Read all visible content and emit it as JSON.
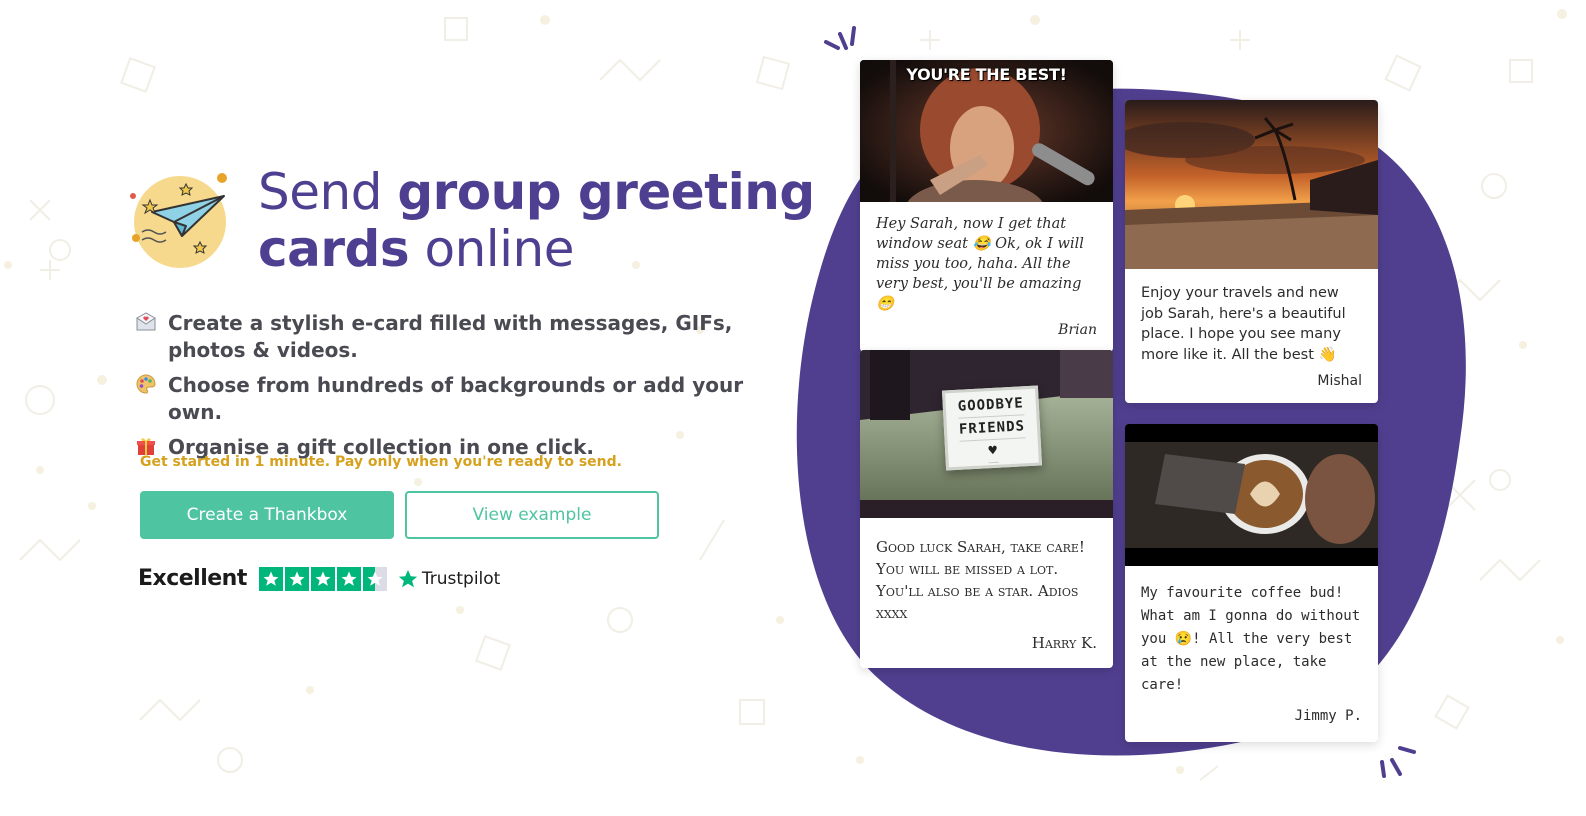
{
  "headline": {
    "part1": "Send ",
    "bold": "group greeting cards",
    "part2": " online"
  },
  "features": [
    {
      "icon": "envelope-heart-icon",
      "text": "Create a stylish e-card filled with messages, GIFs, photos & videos."
    },
    {
      "icon": "palette-icon",
      "text": "Choose from hundreds of backgrounds or add your own."
    },
    {
      "icon": "gift-icon",
      "text": "Organise a gift collection in one click."
    }
  ],
  "tagline": "Get started in 1 minute. Pay only when you're ready to send.",
  "buttons": {
    "primary": "Create a Thankbox",
    "secondary": "View example"
  },
  "rating": {
    "label": "Excellent",
    "stars": 4.5,
    "brand": "Trustpilot"
  },
  "cards": [
    {
      "gif_text": "YOU'RE THE BEST!",
      "message": "Hey Sarah, now I get that window seat 😂 Ok, ok I will miss you too, haha. All the very best, you'll be amazing 😁",
      "signature": "Brian"
    },
    {
      "lightbox_line1": "GOODBYE",
      "lightbox_line2": "FRIENDS",
      "lightbox_symbol": "♥",
      "message": "Good luck Sarah, take care! You will be missed a lot. You'll also be a star. Adios xxxx",
      "signature": "Harry K."
    },
    {
      "message": "Enjoy your travels and new job Sarah, here's a beautiful place. I hope you see many more like it. All the best 👋",
      "signature": "Mishal"
    },
    {
      "message": "My favourite coffee bud! What am I gonna do without you 😢! All the very best at the new place, take care!",
      "signature": "Jimmy P."
    }
  ],
  "colors": {
    "brand_purple": "#4f3f91",
    "accent_green": "#4fc4a0",
    "tagline_gold": "#d6a21e",
    "trustpilot_green": "#00b67a"
  }
}
